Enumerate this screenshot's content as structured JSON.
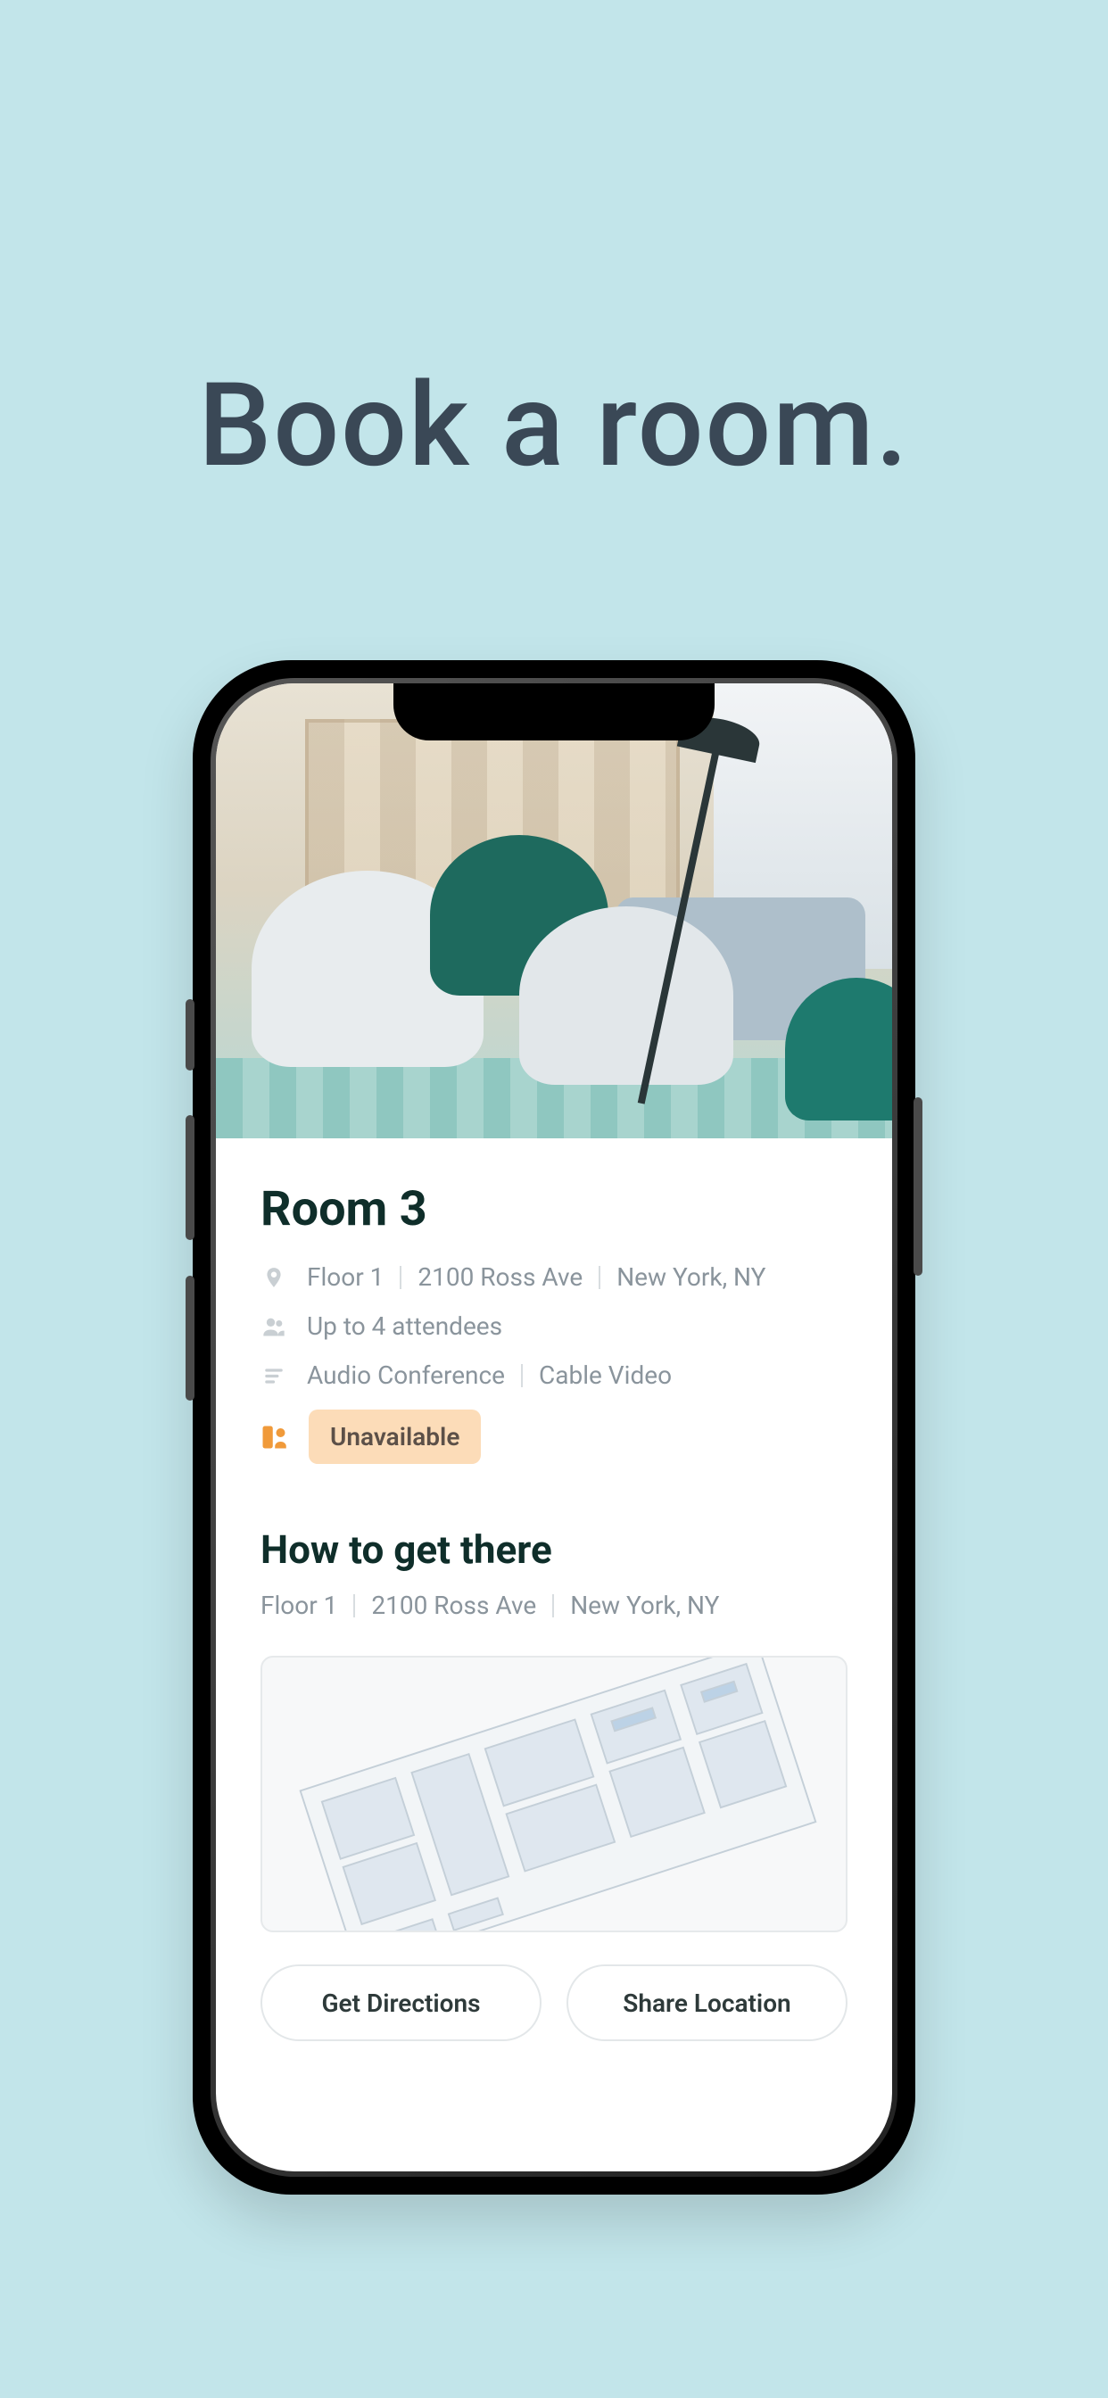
{
  "hero": {
    "title": "Book a room."
  },
  "room": {
    "title": "Room 3",
    "location": {
      "floor": "Floor 1",
      "address": "2100 Ross Ave",
      "city": "New York, NY"
    },
    "capacity": "Up to 4 attendees",
    "amenities": [
      "Audio Conference",
      "Cable Video"
    ],
    "status": {
      "label": "Unavailable"
    }
  },
  "directions": {
    "heading": "How to get there",
    "location": {
      "floor": "Floor 1",
      "address": "2100 Ross Ave",
      "city": "New York, NY"
    },
    "buttons": {
      "get_directions": "Get Directions",
      "share_location": "Share Location"
    }
  }
}
